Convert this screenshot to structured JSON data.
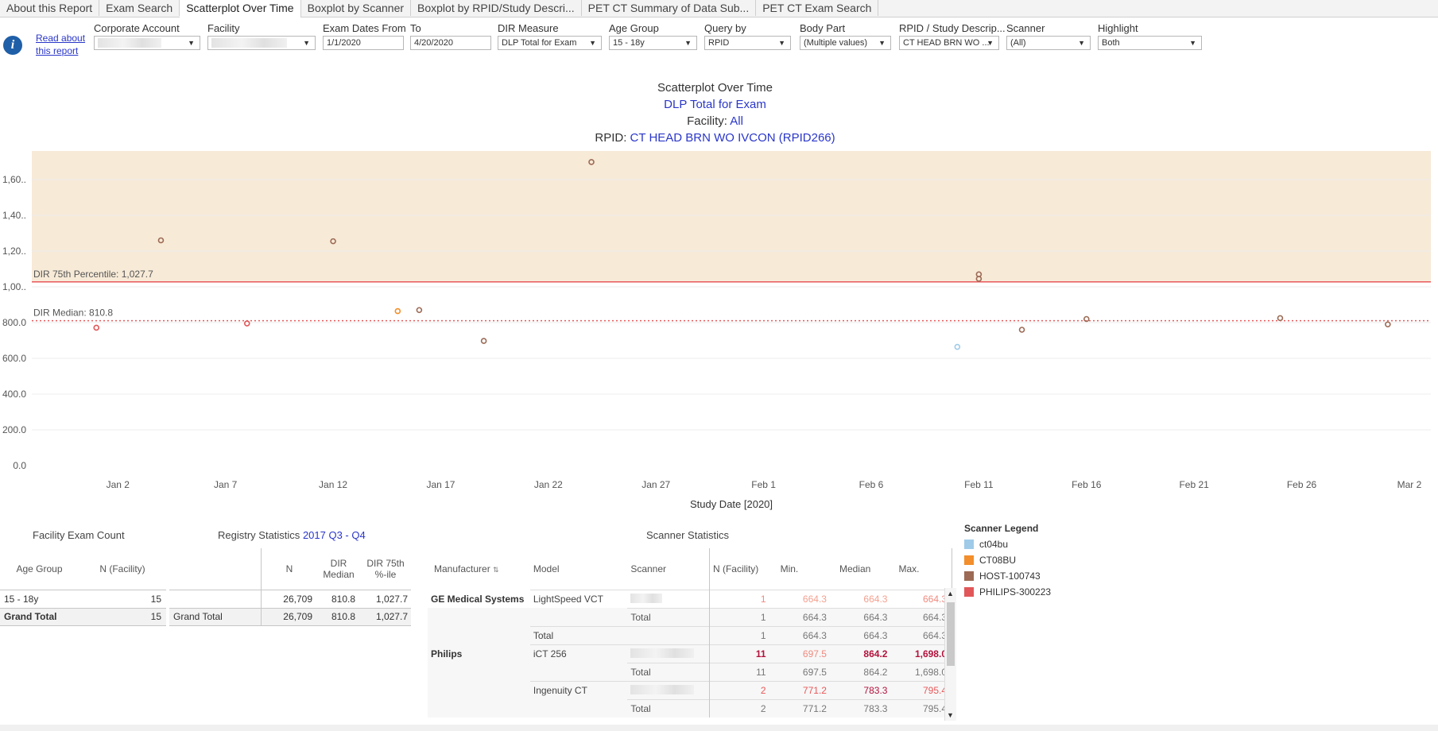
{
  "tabs": [
    {
      "label": "About this Report",
      "active": false
    },
    {
      "label": "Exam Search",
      "active": false
    },
    {
      "label": "Scatterplot Over Time",
      "active": true
    },
    {
      "label": "Boxplot by Scanner",
      "active": false
    },
    {
      "label": "Boxplot by RPID/Study Descri...",
      "active": false
    },
    {
      "label": "PET CT Summary of Data Sub...",
      "active": false
    },
    {
      "label": "PET CT Exam Search",
      "active": false
    }
  ],
  "info": {
    "icon": "info-icon",
    "link_text": "Read about this report"
  },
  "filters": [
    {
      "label": "Corporate Account",
      "value": "",
      "dropdown": true
    },
    {
      "label": "Facility",
      "value": "",
      "dropdown": true
    },
    {
      "label": "Exam Dates From",
      "value": "1/1/2020",
      "dropdown": false
    },
    {
      "label": "To",
      "value": "4/20/2020",
      "dropdown": false
    },
    {
      "label": "DIR Measure",
      "value": "DLP Total for Exam",
      "dropdown": true
    },
    {
      "label": "Age Group",
      "value": "15 - 18y",
      "dropdown": true
    },
    {
      "label": "Query by",
      "value": "RPID",
      "dropdown": true
    },
    {
      "label": "Body Part",
      "value": "(Multiple values)",
      "dropdown": true
    },
    {
      "label": "RPID / Study Descrip...",
      "value": "CT HEAD BRN WO ...",
      "dropdown": true
    },
    {
      "label": "Scanner",
      "value": "(All)",
      "dropdown": true
    },
    {
      "label": "Highlight",
      "value": "Both",
      "dropdown": true
    }
  ],
  "chart_titles": {
    "title": "Scatterplot Over Time",
    "measure": "DLP Total for Exam",
    "facility_label": "Facility:",
    "facility_value": "All",
    "rpid_label": "RPID:",
    "rpid_value": "CT HEAD BRN WO IVCON (RPID266)"
  },
  "chart_data": {
    "type": "scatter",
    "title": "Scatterplot Over Time",
    "xlabel": "Study Date [2020]",
    "ylabel": "",
    "x_ticks": [
      "Jan 2",
      "Jan 7",
      "Jan 12",
      "Jan 17",
      "Jan 22",
      "Jan 27",
      "Feb 1",
      "Feb 6",
      "Feb 11",
      "Feb 16",
      "Feb 21",
      "Feb 26",
      "Mar 2"
    ],
    "y_ticks": [
      "0.0",
      "200.0",
      "400.0",
      "600.0",
      "800.0",
      "1,00..",
      "1,20..",
      "1,40..",
      "1,60.."
    ],
    "ylim": [
      0,
      1760
    ],
    "xlim": [
      "2019-12-29",
      "2020-03-03"
    ],
    "grid": true,
    "reference_lines": [
      {
        "label": "DIR 75th Percentile: 1,027.7",
        "value": 1027.7,
        "style": "solid",
        "color": "#e8585a"
      },
      {
        "label": "DIR Median: 810.8",
        "value": 810.8,
        "style": "dotted",
        "color": "#e8585a"
      }
    ],
    "band_color": "#f7ead7",
    "series": [
      {
        "name": "ct04bu",
        "color": "#9fcbe9",
        "points": [
          {
            "x": "2020-02-10",
            "y": 664.3
          }
        ]
      },
      {
        "name": "CT08BU",
        "color": "#f28e2b",
        "points": [
          {
            "x": "2020-01-15",
            "y": 864
          }
        ]
      },
      {
        "name": "HOST-100743",
        "color": "#9c6a55",
        "points": [
          {
            "x": "2020-01-04",
            "y": 1260
          },
          {
            "x": "2020-01-12",
            "y": 1255
          },
          {
            "x": "2020-01-16",
            "y": 870
          },
          {
            "x": "2020-01-19",
            "y": 697.5
          },
          {
            "x": "2020-01-24",
            "y": 1698
          },
          {
            "x": "2020-02-11",
            "y": 1070
          },
          {
            "x": "2020-02-11",
            "y": 1045
          },
          {
            "x": "2020-02-13",
            "y": 760
          },
          {
            "x": "2020-02-16",
            "y": 820
          },
          {
            "x": "2020-02-25",
            "y": 825
          },
          {
            "x": "2020-03-01",
            "y": 790
          }
        ]
      },
      {
        "name": "PHILIPS-300223",
        "color": "#e15759",
        "points": [
          {
            "x": "2020-01-01",
            "y": 771.2
          },
          {
            "x": "2020-01-08",
            "y": 795.4
          }
        ]
      }
    ]
  },
  "facility_exam_count": {
    "title": "Facility Exam Count",
    "headers": [
      "Age Group",
      "N (Facility)"
    ],
    "rows": [
      [
        "15 - 18y",
        "15"
      ]
    ],
    "total": [
      "Grand Total",
      "15"
    ]
  },
  "registry_stats": {
    "title": "Registry Statistics",
    "period": "2017 Q3 - Q4",
    "headers": [
      "N",
      "DIR Median",
      "DIR 75th %-ile"
    ],
    "rows": [
      [
        "",
        "26,709",
        "810.8",
        "1,027.7"
      ]
    ],
    "total": [
      "Grand Total",
      "26,709",
      "810.8",
      "1,027.7"
    ]
  },
  "scanner_stats": {
    "title": "Scanner Statistics",
    "headers": [
      "Manufacturer",
      "Model",
      "Scanner",
      "N (Facility)",
      "Min.",
      "Median",
      "Max."
    ],
    "rows": [
      {
        "manufacturer": "GE Medical Systems",
        "model": "LightSpeed VCT",
        "scanner": "",
        "n": "1",
        "min": "664.3",
        "median": "664.3",
        "max": "664.3",
        "kind": "data-light"
      },
      {
        "manufacturer": "",
        "model": "",
        "scanner": "Total",
        "n": "1",
        "min": "664.3",
        "median": "664.3",
        "max": "664.3",
        "kind": "total"
      },
      {
        "manufacturer": "",
        "model": "Total",
        "scanner": "",
        "n": "1",
        "min": "664.3",
        "median": "664.3",
        "max": "664.3",
        "kind": "total"
      },
      {
        "manufacturer": "Philips",
        "model": "iCT 256",
        "scanner": "",
        "n": "11",
        "min": "697.5",
        "median": "864.2",
        "max": "1,698.0",
        "kind": "data-dark"
      },
      {
        "manufacturer": "",
        "model": "",
        "scanner": "Total",
        "n": "11",
        "min": "697.5",
        "median": "864.2",
        "max": "1,698.0",
        "kind": "total"
      },
      {
        "manufacturer": "",
        "model": "Ingenuity CT",
        "scanner": "",
        "n": "2",
        "min": "771.2",
        "median": "783.3",
        "max": "795.4",
        "kind": "data-mid"
      },
      {
        "manufacturer": "",
        "model": "",
        "scanner": "Total",
        "n": "2",
        "min": "771.2",
        "median": "783.3",
        "max": "795.4",
        "kind": "total"
      }
    ]
  },
  "legend": {
    "title": "Scanner Legend",
    "items": [
      {
        "label": "ct04bu",
        "color": "#9fcbe9"
      },
      {
        "label": "CT08BU",
        "color": "#f28e2b"
      },
      {
        "label": "HOST-100743",
        "color": "#9c6a55"
      },
      {
        "label": "PHILIPS-300223",
        "color": "#e15759"
      }
    ]
  }
}
